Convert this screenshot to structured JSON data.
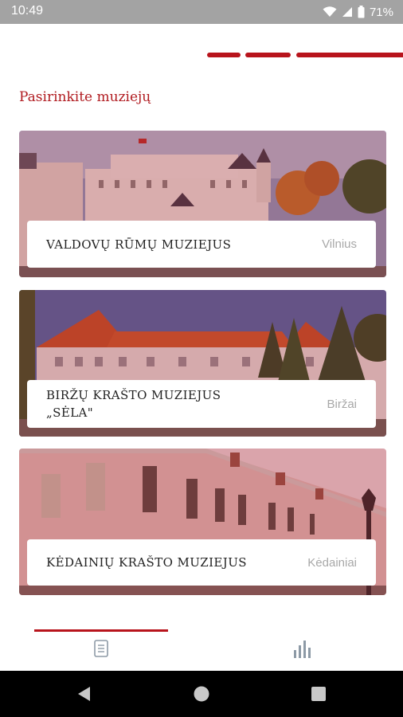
{
  "status_bar": {
    "time": "10:49",
    "battery": "71%",
    "icons": [
      "wifi-icon",
      "signal-icon",
      "battery-icon"
    ]
  },
  "header": {
    "progress_segments": 3,
    "accent_color": "#b8141c"
  },
  "section_title": "Pasirinkite muziejų",
  "museums": [
    {
      "name": "VALDOVŲ RŪMŲ MUZIEJUS",
      "city": "Vilnius"
    },
    {
      "name": "BIRŽŲ KRAŠTO MUZIEJUS\n„SĖLA\"",
      "city": "Biržai"
    },
    {
      "name": "KĖDAINIŲ KRAŠTO MUZIEJUS",
      "city": "Kėdainiai"
    }
  ],
  "bottom_nav": {
    "tabs": [
      "document-icon",
      "bar-chart-icon"
    ],
    "active_tab": 0
  },
  "system_nav": [
    "back-icon",
    "home-icon",
    "recents-icon"
  ]
}
